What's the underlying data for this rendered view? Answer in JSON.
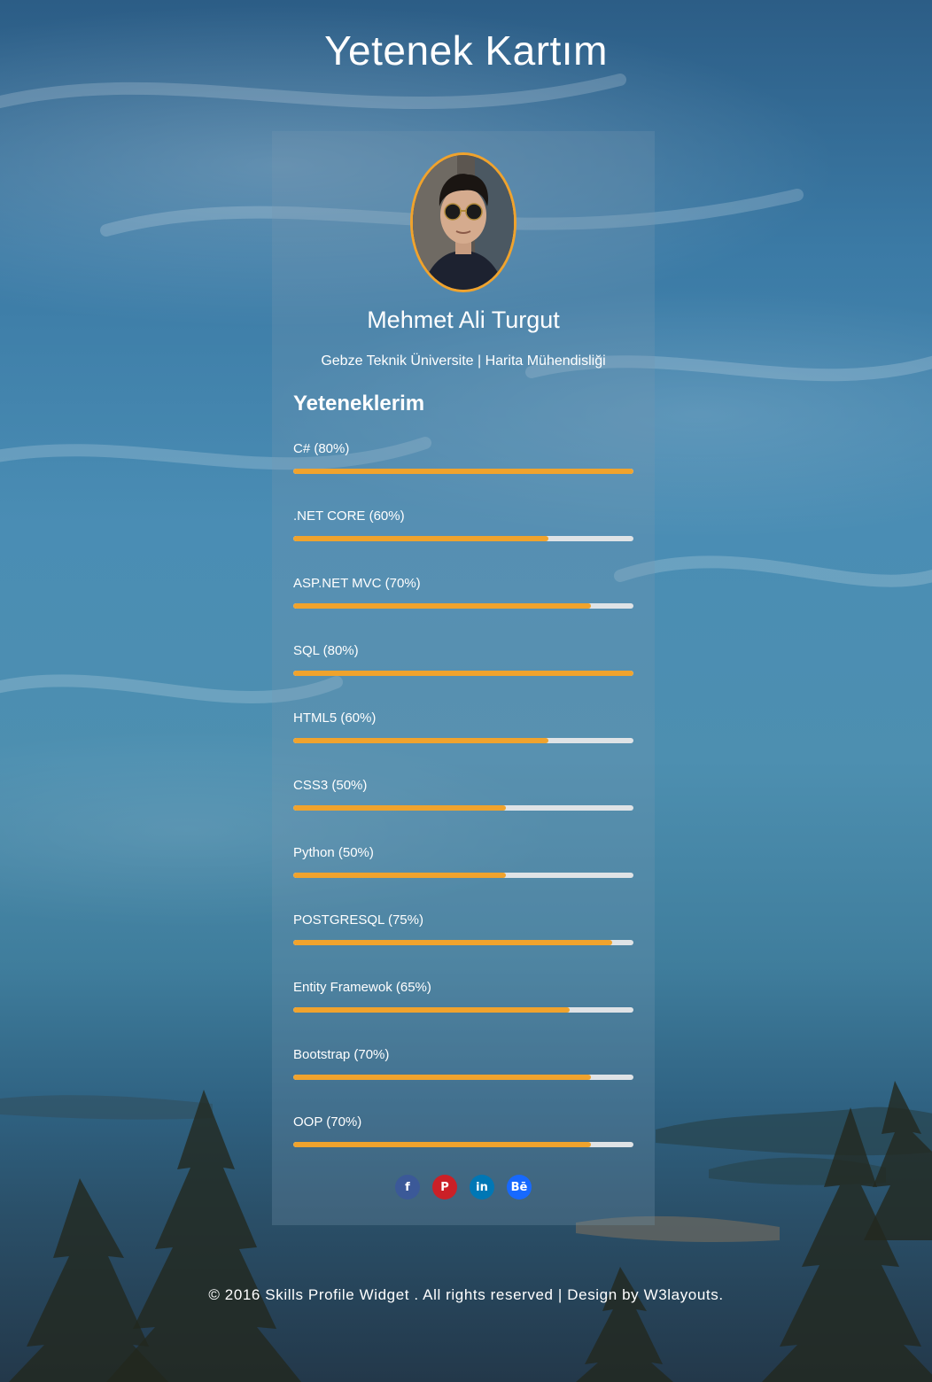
{
  "page": {
    "title": "Yetenek Kartım"
  },
  "profile": {
    "name": "Mehmet Ali Turgut",
    "subtitle": "Gebze Teknik Üniversite | Harita Mühendisliği",
    "accent_color": "#f0a32d"
  },
  "skills": {
    "heading": "Yeteneklerim",
    "items": [
      {
        "label": "C# (80%)",
        "level": 1.0
      },
      {
        "label": ".NET CORE (60%)",
        "level": 0.75
      },
      {
        "label": "ASP.NET MVC (70%)",
        "level": 0.875
      },
      {
        "label": "SQL (80%)",
        "level": 1.0
      },
      {
        "label": "HTML5 (60%)",
        "level": 0.75
      },
      {
        "label": "CSS3 (50%)",
        "level": 0.625
      },
      {
        "label": "Python (50%)",
        "level": 0.625
      },
      {
        "label": "POSTGRESQL (75%)",
        "level": 0.9375
      },
      {
        "label": "Entity Framewok (65%)",
        "level": 0.8125
      },
      {
        "label": "Bootstrap (70%)",
        "level": 0.875
      },
      {
        "label": "OOP (70%)",
        "level": 0.875
      }
    ],
    "fill_color": "#f0a32d",
    "track_color": "#dfe3e6"
  },
  "social": [
    {
      "name": "facebook",
      "icon": "facebook-icon",
      "glyph": "f",
      "color": "#3b5998"
    },
    {
      "name": "pinterest",
      "icon": "pinterest-icon",
      "glyph": "P",
      "color": "#cb2027"
    },
    {
      "name": "linkedin",
      "icon": "linkedin-icon",
      "glyph": "in",
      "color": "#0077b5"
    },
    {
      "name": "behance",
      "icon": "behance-icon",
      "glyph": "Bē",
      "color": "#1769ff"
    }
  ],
  "footer": {
    "text": "© 2016 Skills Profile Widget . All rights reserved | Design by W3layouts."
  }
}
